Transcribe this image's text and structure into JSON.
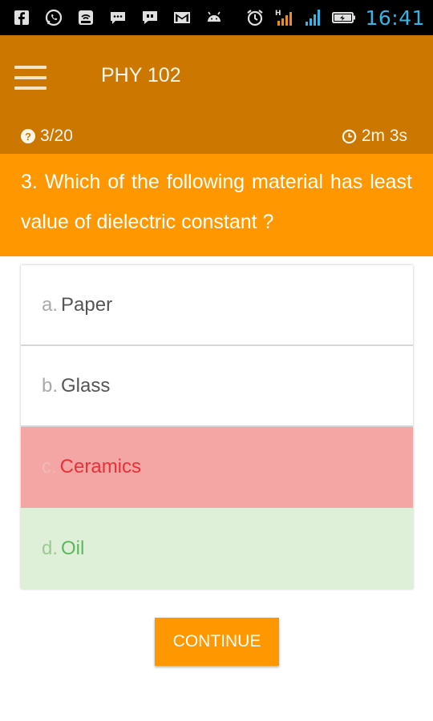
{
  "status_bar": {
    "time": "16:41",
    "icons": [
      "facebook-icon",
      "whatsapp-icon",
      "wifi-router-icon",
      "chat-icon",
      "messenger-icon",
      "gmail-icon",
      "android-icon",
      "alarm-clock-icon",
      "signal-h-icon",
      "signal-icon",
      "battery-icon"
    ]
  },
  "app_bar": {
    "title": "PHY 102",
    "progress": "3/20",
    "timer": "2m 3s",
    "color": "#cc7700"
  },
  "question": {
    "text": "3. Which of the following material has least value of dielectric constant ?",
    "color": "#ff9800"
  },
  "options": [
    {
      "letter": "a.",
      "label": "Paper",
      "state": "normal"
    },
    {
      "letter": "b.",
      "label": "Glass",
      "state": "normal"
    },
    {
      "letter": "c.",
      "label": "Ceramics",
      "state": "wrong"
    },
    {
      "letter": "d.",
      "label": "Oil",
      "state": "correct"
    }
  ],
  "continue_label": "CONTINUE",
  "colors": {
    "wrong_bg": "#f4a6a4",
    "wrong_text": "#e8313a",
    "correct_bg": "#dff0d8",
    "correct_text": "#5cb85c",
    "clock": "#33b5e5"
  }
}
